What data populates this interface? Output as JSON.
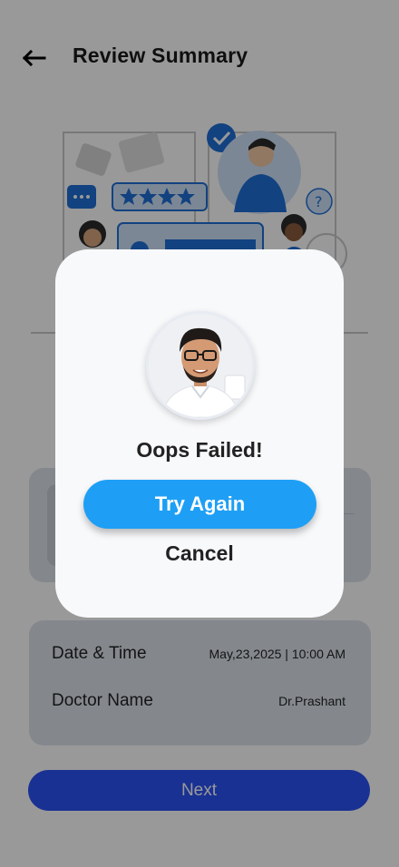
{
  "header": {
    "title": "Review Summary",
    "back_icon": "arrow-left-icon"
  },
  "details": {
    "rows": [
      {
        "label": "Date & Time",
        "value": "May,23,2025 | 10:00 AM"
      },
      {
        "label": "Doctor Name",
        "value": "Dr.Prashant"
      }
    ]
  },
  "footer": {
    "next_label": "Next"
  },
  "modal": {
    "title": "Oops Failed!",
    "try_again_label": "Try Again",
    "cancel_label": "Cancel"
  },
  "colors": {
    "primary_blue": "#2a53f4",
    "try_again_blue": "#1e9ff5",
    "card_bg": "#dde3ec",
    "overlay": "rgba(0,0,0,0.40)"
  }
}
